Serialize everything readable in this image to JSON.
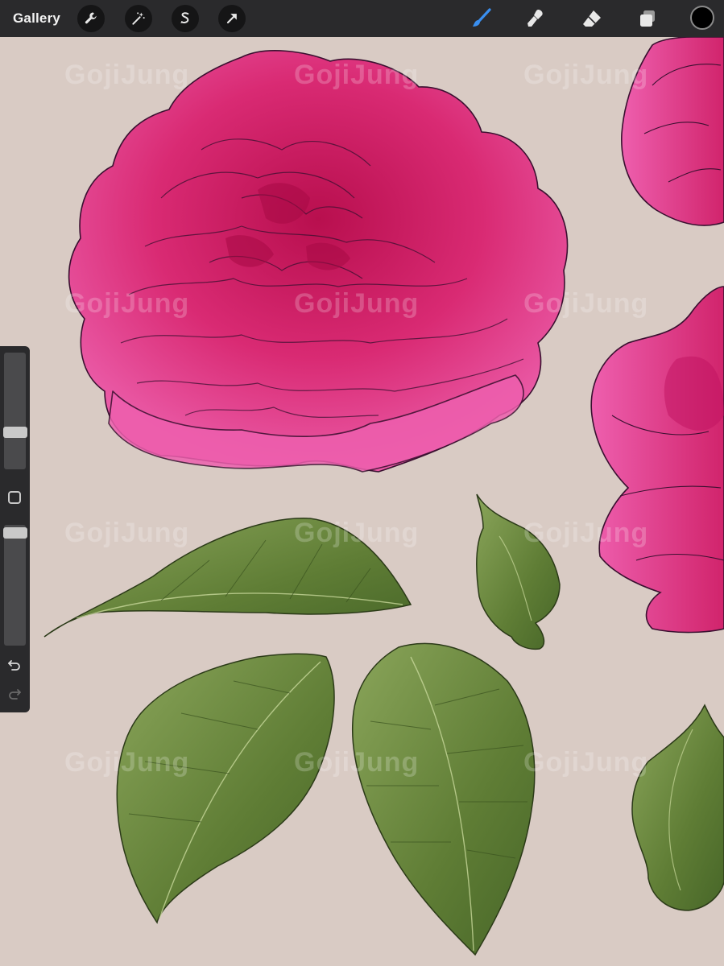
{
  "toolbar": {
    "gallery_label": "Gallery",
    "actions": [
      {
        "name": "wrench-icon",
        "label": "Actions"
      },
      {
        "name": "magic-wand-icon",
        "label": "Adjustments"
      },
      {
        "name": "selection-icon",
        "label": "Selection"
      },
      {
        "name": "transform-arrow-icon",
        "label": "Transform"
      }
    ],
    "tools": [
      {
        "name": "brush-icon",
        "active": true
      },
      {
        "name": "smudge-icon",
        "active": false
      },
      {
        "name": "eraser-icon",
        "active": false
      },
      {
        "name": "layers-icon",
        "active": false
      }
    ],
    "current_color": "#000000",
    "active_tool_color": "#3a8ff0"
  },
  "sidebar": {
    "brush_size": 0.3,
    "opacity": 0.98
  },
  "watermark": "GojiJung",
  "colors": {
    "canvas": "#d9cbc4",
    "petal_deep": "#c8145a",
    "petal_light": "#e8559e",
    "leaf_dark": "#4f6a2c",
    "leaf_light": "#86a054"
  }
}
